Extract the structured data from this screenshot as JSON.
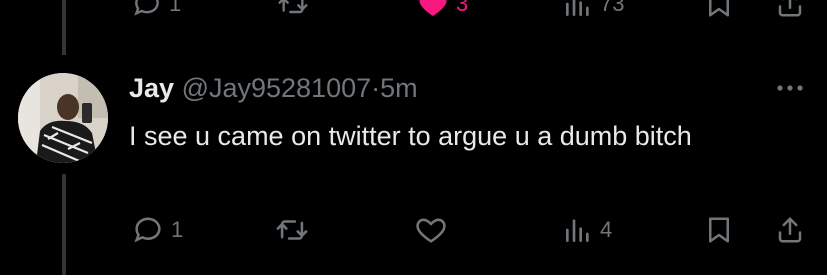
{
  "previous_tweet": {
    "reply_count": "1",
    "like_count": "3",
    "views_count": "73"
  },
  "tweet": {
    "display_name": "Jay",
    "handle": "@Jay95281007",
    "separator": "·",
    "time": "5m",
    "text": "I see u came on twitter to argue u a dumb bitch",
    "reply_count": "1",
    "retweet_count": "",
    "like_count": "",
    "views_count": "4"
  },
  "icons": [
    "reply-icon",
    "retweet-icon",
    "like-icon",
    "views-icon",
    "bookmark-icon",
    "share-icon",
    "more-icon"
  ],
  "colors": {
    "background": "#000000",
    "text": "#e7e9ea",
    "muted": "#71767b",
    "like": "#f91880"
  }
}
